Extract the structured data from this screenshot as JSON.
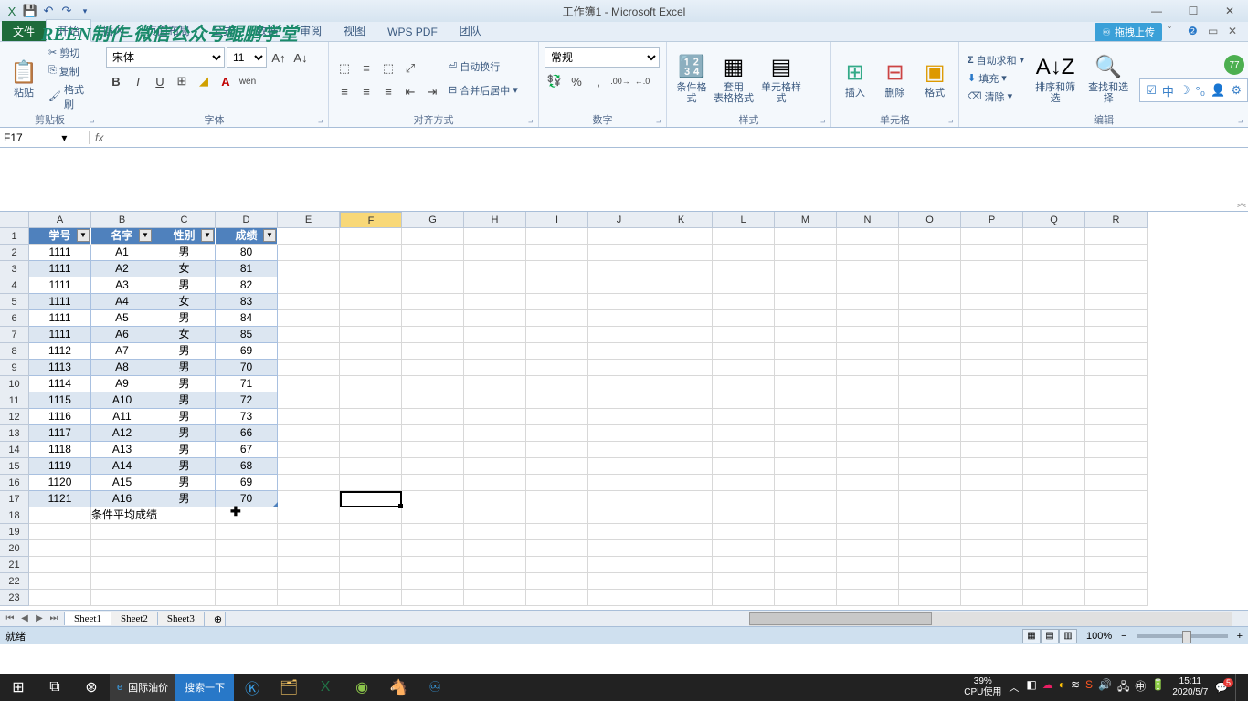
{
  "title": "工作簿1 - Microsoft Excel",
  "watermark": "REEN制作-微信公众号鲲鹏学堂",
  "qat": {
    "save": "💾",
    "undo": "↶",
    "redo": "↷"
  },
  "win": {
    "min": "—",
    "max": "☐",
    "close": "✕"
  },
  "tabs": {
    "file": "文件",
    "items": [
      "开始",
      "插入",
      "页面布局",
      "公式",
      "数据",
      "审阅",
      "视图",
      "WPS PDF",
      "团队"
    ],
    "upload": "拖拽上传"
  },
  "ribbon": {
    "clipboard": {
      "paste": "粘贴",
      "cut": "剪切",
      "copy": "复制",
      "format": "格式刷",
      "label": "剪贴板"
    },
    "font": {
      "name": "宋体",
      "size": "11",
      "label": "字体"
    },
    "align": {
      "wrap": "自动换行",
      "merge": "合并后居中",
      "label": "对齐方式"
    },
    "number": {
      "format": "常规",
      "label": "数字"
    },
    "styles": {
      "cond": "条件格式",
      "table": "套用\n表格格式",
      "cell": "单元格样式",
      "label": "样式"
    },
    "cells": {
      "insert": "插入",
      "delete": "删除",
      "format": "格式",
      "label": "单元格"
    },
    "editing": {
      "sum": "自动求和",
      "fill": "填充",
      "clear": "清除",
      "sort": "排序和筛选",
      "find": "查找和选择",
      "label": "编辑"
    }
  },
  "namebox": "F17",
  "columns": [
    "A",
    "B",
    "C",
    "D",
    "E",
    "F",
    "G",
    "H",
    "I",
    "J",
    "K",
    "L",
    "M",
    "N",
    "O",
    "P",
    "Q",
    "R"
  ],
  "headers": [
    "学号",
    "名字",
    "性别",
    "成绩"
  ],
  "rows": [
    [
      "1111",
      "A1",
      "男",
      "80"
    ],
    [
      "1111",
      "A2",
      "女",
      "81"
    ],
    [
      "1111",
      "A3",
      "男",
      "82"
    ],
    [
      "1111",
      "A4",
      "女",
      "83"
    ],
    [
      "1111",
      "A5",
      "男",
      "84"
    ],
    [
      "1111",
      "A6",
      "女",
      "85"
    ],
    [
      "1112",
      "A7",
      "男",
      "69"
    ],
    [
      "1113",
      "A8",
      "男",
      "70"
    ],
    [
      "1114",
      "A9",
      "男",
      "71"
    ],
    [
      "1115",
      "A10",
      "男",
      "72"
    ],
    [
      "1116",
      "A11",
      "男",
      "73"
    ],
    [
      "1117",
      "A12",
      "男",
      "66"
    ],
    [
      "1118",
      "A13",
      "男",
      "67"
    ],
    [
      "1119",
      "A14",
      "男",
      "68"
    ],
    [
      "1120",
      "A15",
      "男",
      "69"
    ],
    [
      "1121",
      "A16",
      "男",
      "70"
    ]
  ],
  "footer_row_label": "条件平均成绩",
  "sheets": [
    "Sheet1",
    "Sheet2",
    "Sheet3"
  ],
  "status": {
    "ready": "就绪",
    "zoom": "100%"
  },
  "taskbar": {
    "search_placeholder": "国际油价",
    "search_btn": "搜索一下",
    "cpu_pct": "39%",
    "cpu_lbl": "CPU使用",
    "time": "15:11",
    "date": "2020/5/7",
    "notif": "5"
  }
}
